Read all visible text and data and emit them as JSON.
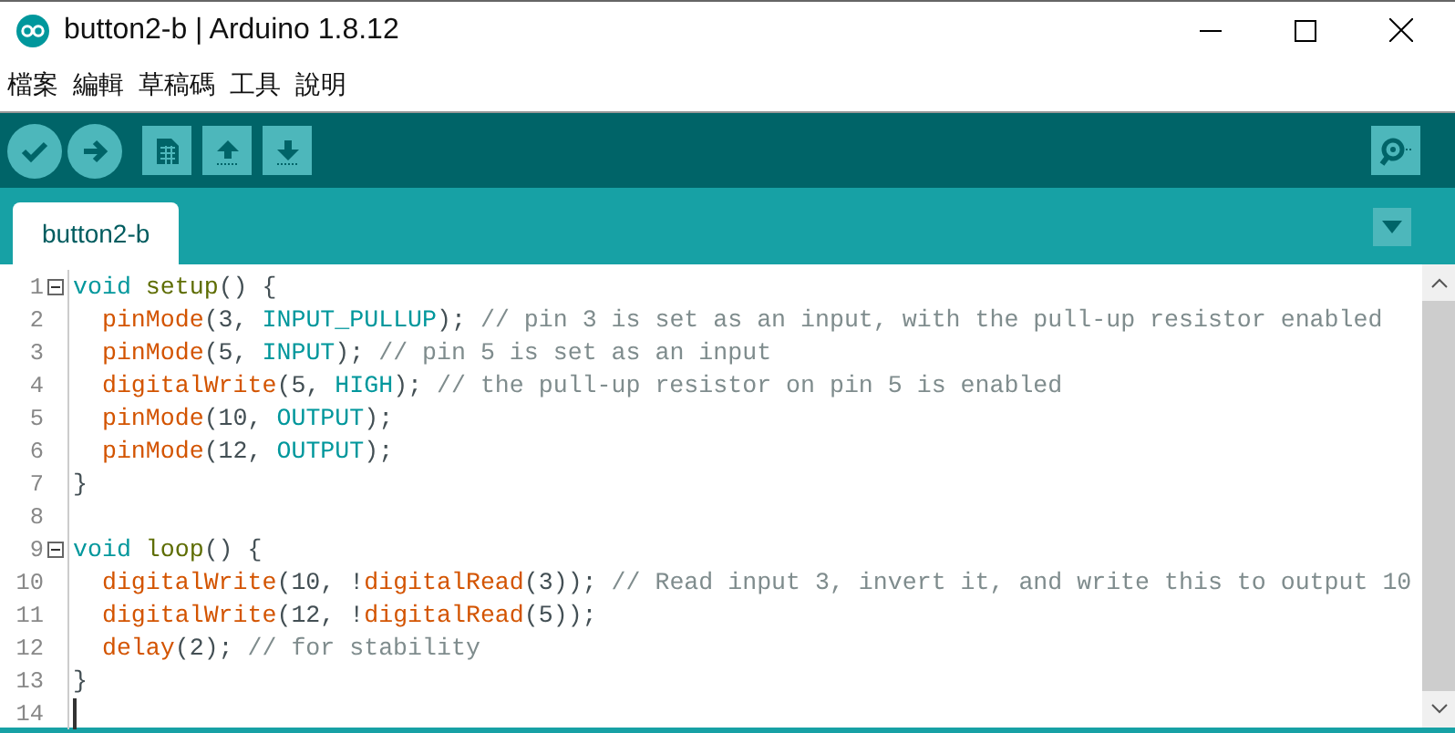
{
  "window": {
    "title": "button2-b | Arduino 1.8.12"
  },
  "menu": [
    "檔案",
    "編輯",
    "草稿碼",
    "工具",
    "說明"
  ],
  "toolbar": {
    "buttons": [
      {
        "kind": "verify"
      },
      {
        "kind": "upload"
      },
      {
        "kind": "new"
      },
      {
        "kind": "open"
      },
      {
        "kind": "save"
      }
    ]
  },
  "tabs": [
    {
      "label": "button2-b",
      "selected": true
    }
  ],
  "editor": {
    "lines": [
      {
        "number": "1",
        "fold": true,
        "tokens": [
          {
            "t": "void ",
            "kind": "type"
          },
          {
            "t": "setup",
            "kind": "struct"
          },
          {
            "t": "() {",
            "kind": "plain"
          }
        ]
      },
      {
        "number": "2",
        "fold": false,
        "tokens": [
          {
            "t": "  pinMode",
            "kind": "func"
          },
          {
            "t": "(3, ",
            "kind": "plain"
          },
          {
            "t": "INPUT_PULLUP",
            "kind": "const"
          },
          {
            "t": "); ",
            "kind": "plain"
          },
          {
            "t": "// pin 3 is set as an input, with the pull-up resistor enabled",
            "kind": "comment"
          }
        ]
      },
      {
        "number": "3",
        "fold": false,
        "tokens": [
          {
            "t": "  pinMode",
            "kind": "func"
          },
          {
            "t": "(5, ",
            "kind": "plain"
          },
          {
            "t": "INPUT",
            "kind": "const"
          },
          {
            "t": "); ",
            "kind": "plain"
          },
          {
            "t": "// pin 5 is set as an input",
            "kind": "comment"
          }
        ]
      },
      {
        "number": "4",
        "fold": false,
        "tokens": [
          {
            "t": "  digitalWrite",
            "kind": "func"
          },
          {
            "t": "(5, ",
            "kind": "plain"
          },
          {
            "t": "HIGH",
            "kind": "const"
          },
          {
            "t": "); ",
            "kind": "plain"
          },
          {
            "t": "// the pull-up resistor on pin 5 is enabled",
            "kind": "comment"
          }
        ]
      },
      {
        "number": "5",
        "fold": false,
        "tokens": [
          {
            "t": "  pinMode",
            "kind": "func"
          },
          {
            "t": "(10, ",
            "kind": "plain"
          },
          {
            "t": "OUTPUT",
            "kind": "const"
          },
          {
            "t": ");",
            "kind": "plain"
          }
        ]
      },
      {
        "number": "6",
        "fold": false,
        "tokens": [
          {
            "t": "  pinMode",
            "kind": "func"
          },
          {
            "t": "(12, ",
            "kind": "plain"
          },
          {
            "t": "OUTPUT",
            "kind": "const"
          },
          {
            "t": ");",
            "kind": "plain"
          }
        ]
      },
      {
        "number": "7",
        "fold": false,
        "tokens": [
          {
            "t": "}",
            "kind": "plain"
          }
        ]
      },
      {
        "number": "8",
        "fold": false
      },
      {
        "number": "9",
        "fold": true,
        "tokens": [
          {
            "t": "void ",
            "kind": "type"
          },
          {
            "t": "loop",
            "kind": "struct"
          },
          {
            "t": "() {",
            "kind": "plain"
          }
        ]
      },
      {
        "number": "10",
        "fold": false,
        "tokens": [
          {
            "t": "  digitalWrite",
            "kind": "func"
          },
          {
            "t": "(10, !",
            "kind": "plain"
          },
          {
            "t": "digitalRead",
            "kind": "func"
          },
          {
            "t": "(3)); ",
            "kind": "plain"
          },
          {
            "t": "// Read input 3, invert it, and write this to output 10",
            "kind": "comment"
          }
        ]
      },
      {
        "number": "11",
        "fold": false,
        "tokens": [
          {
            "t": "  digitalWrite",
            "kind": "func"
          },
          {
            "t": "(12, !",
            "kind": "plain"
          },
          {
            "t": "digitalRead",
            "kind": "func"
          },
          {
            "t": "(5));",
            "kind": "plain"
          }
        ]
      },
      {
        "number": "12",
        "fold": false,
        "tokens": [
          {
            "t": "  delay",
            "kind": "func"
          },
          {
            "t": "(2); ",
            "kind": "plain"
          },
          {
            "t": "// for stability",
            "kind": "comment"
          }
        ]
      },
      {
        "number": "13",
        "fold": false,
        "tokens": [
          {
            "t": "}",
            "kind": "plain"
          }
        ]
      },
      {
        "number": "14",
        "fold": false,
        "cursor": true
      }
    ]
  }
}
